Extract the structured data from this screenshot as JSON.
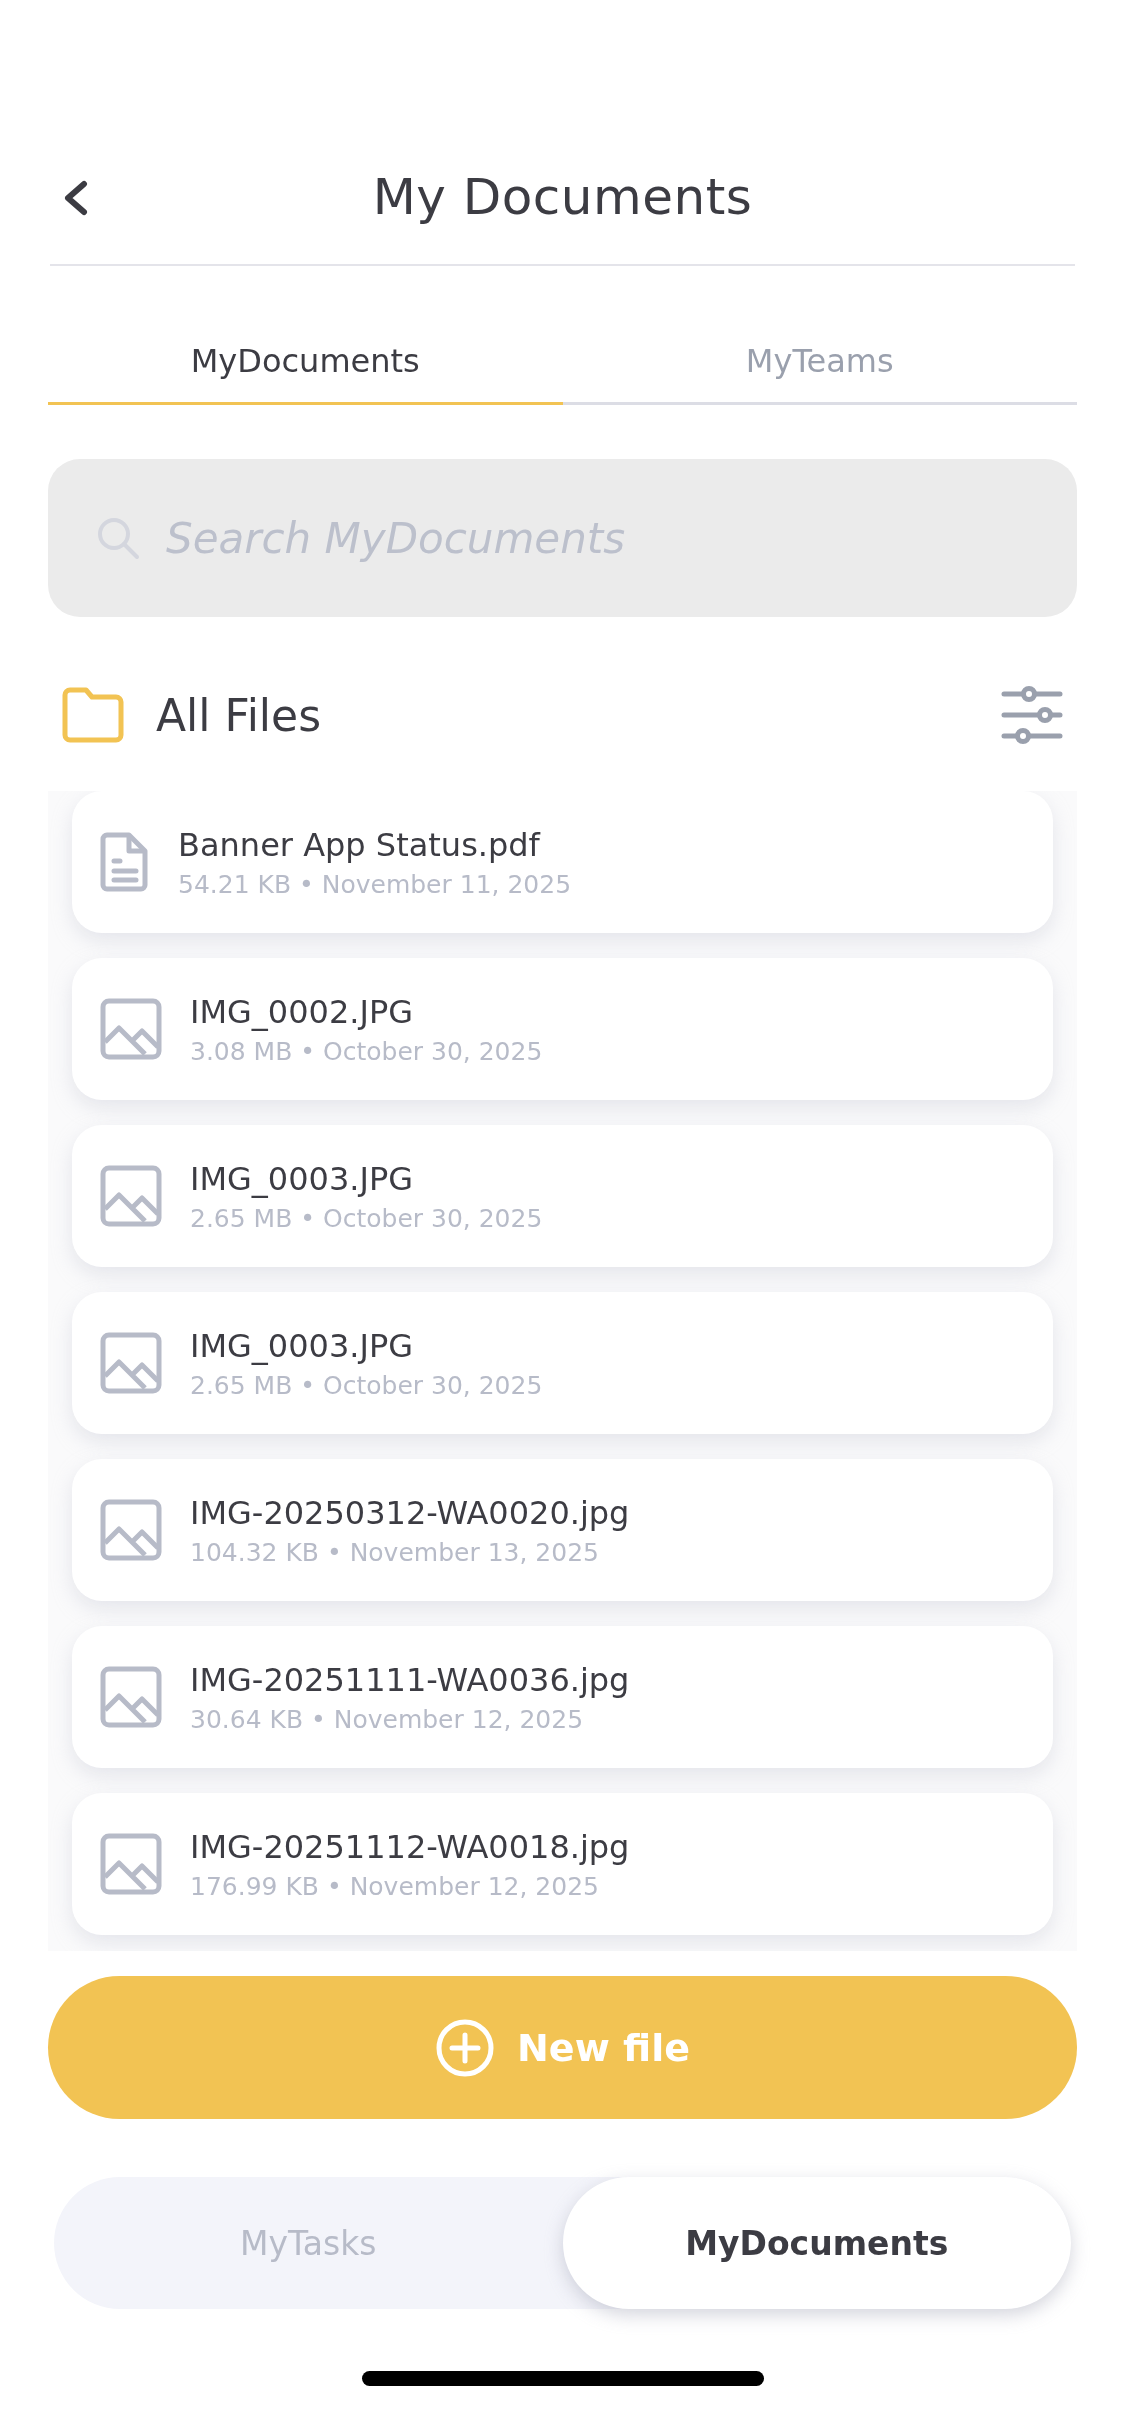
{
  "header": {
    "title": "My Documents"
  },
  "tabs": [
    {
      "label": "MyDocuments",
      "selected": true
    },
    {
      "label": "MyTeams",
      "selected": false
    }
  ],
  "search": {
    "placeholder": "Search MyDocuments"
  },
  "folder": {
    "label": "All Files"
  },
  "files": [
    {
      "kind": "document",
      "name": "Banner App Status.pdf",
      "size": "54.21 KB",
      "date": "November 11, 2025"
    },
    {
      "kind": "image",
      "name": "IMG_0002.JPG",
      "size": "3.08 MB",
      "date": "October 30, 2025"
    },
    {
      "kind": "image",
      "name": "IMG_0003.JPG",
      "size": "2.65 MB",
      "date": "October 30, 2025"
    },
    {
      "kind": "image",
      "name": "IMG_0003.JPG",
      "size": "2.65 MB",
      "date": "October 30, 2025"
    },
    {
      "kind": "image",
      "name": "IMG-20250312-WA0020.jpg",
      "size": "104.32 KB",
      "date": "November 13, 2025"
    },
    {
      "kind": "image",
      "name": "IMG-20251111-WA0036.jpg",
      "size": "30.64 KB",
      "date": "November 12, 2025"
    },
    {
      "kind": "image",
      "name": "IMG-20251112-WA0018.jpg",
      "size": "176.99 KB",
      "date": "November 12, 2025"
    }
  ],
  "separator": "•",
  "new_button": {
    "label": "New file"
  },
  "bottom_tabs": [
    {
      "label": "MyTasks",
      "selected": false
    },
    {
      "label": "MyDocuments",
      "selected": true
    }
  ]
}
